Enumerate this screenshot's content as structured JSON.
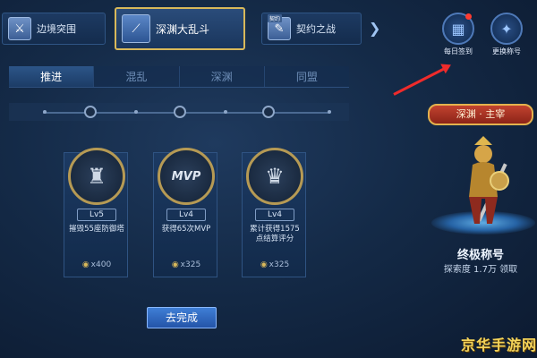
{
  "mode_tabs": [
    {
      "label": "边境突围",
      "icon": "sword-icon"
    },
    {
      "label": "深渊大乱斗",
      "icon": "staff-icon"
    },
    {
      "label": "契约之战",
      "icon": "contract-icon",
      "badge": "契约"
    }
  ],
  "corner_buttons": [
    {
      "label": "每日签到",
      "icon": "calendar-icon"
    },
    {
      "label": "更换称号",
      "icon": "emblem-icon"
    }
  ],
  "sub_tabs": [
    "推进",
    "混乱",
    "深渊",
    "同盟"
  ],
  "achievements": [
    {
      "level": "Lv5",
      "desc": "摧毁55座防御塔",
      "reward": "x400",
      "icon": "tower-icon"
    },
    {
      "level": "Lv4",
      "desc": "获得65次MVP",
      "reward": "x325",
      "icon": "mvp-icon",
      "badge_text": "MVP"
    },
    {
      "level": "Lv4",
      "desc": "累计获得1575点结算评分",
      "reward": "x325",
      "icon": "wings-icon"
    }
  ],
  "go_button": "去完成",
  "title_panel": {
    "banner": "深渊 · 主宰",
    "ultimate": "终极称号",
    "explore": "探索度 1.7万 领取"
  },
  "watermark": "京华手游网",
  "colors": {
    "gold": "#d8b85a",
    "accent_blue": "#3f7fd6",
    "arrow_red": "#ef2b2b"
  }
}
